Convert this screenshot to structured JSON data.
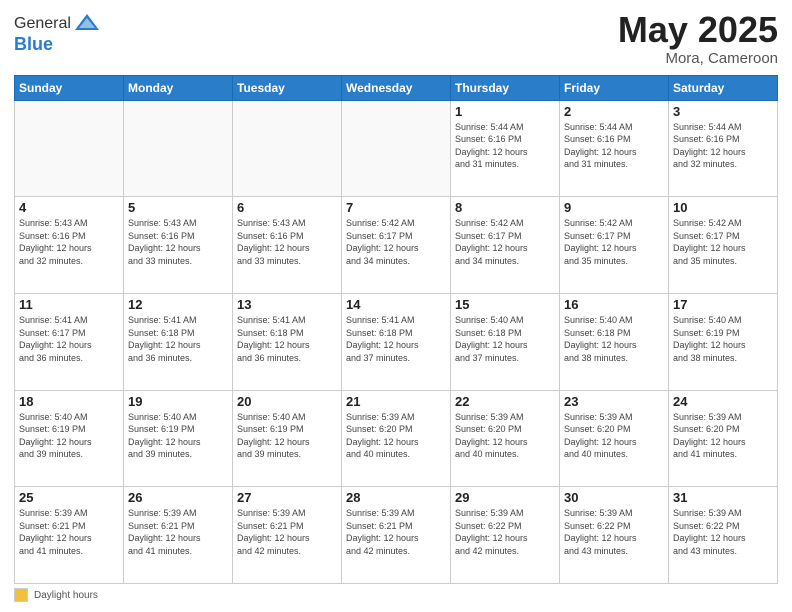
{
  "header": {
    "logo_general": "General",
    "logo_blue": "Blue",
    "title": "May 2025",
    "location": "Mora, Cameroon"
  },
  "weekdays": [
    "Sunday",
    "Monday",
    "Tuesday",
    "Wednesday",
    "Thursday",
    "Friday",
    "Saturday"
  ],
  "weeks": [
    [
      {
        "day": "",
        "info": ""
      },
      {
        "day": "",
        "info": ""
      },
      {
        "day": "",
        "info": ""
      },
      {
        "day": "",
        "info": ""
      },
      {
        "day": "1",
        "info": "Sunrise: 5:44 AM\nSunset: 6:16 PM\nDaylight: 12 hours\nand 31 minutes."
      },
      {
        "day": "2",
        "info": "Sunrise: 5:44 AM\nSunset: 6:16 PM\nDaylight: 12 hours\nand 31 minutes."
      },
      {
        "day": "3",
        "info": "Sunrise: 5:44 AM\nSunset: 6:16 PM\nDaylight: 12 hours\nand 32 minutes."
      }
    ],
    [
      {
        "day": "4",
        "info": "Sunrise: 5:43 AM\nSunset: 6:16 PM\nDaylight: 12 hours\nand 32 minutes."
      },
      {
        "day": "5",
        "info": "Sunrise: 5:43 AM\nSunset: 6:16 PM\nDaylight: 12 hours\nand 33 minutes."
      },
      {
        "day": "6",
        "info": "Sunrise: 5:43 AM\nSunset: 6:16 PM\nDaylight: 12 hours\nand 33 minutes."
      },
      {
        "day": "7",
        "info": "Sunrise: 5:42 AM\nSunset: 6:17 PM\nDaylight: 12 hours\nand 34 minutes."
      },
      {
        "day": "8",
        "info": "Sunrise: 5:42 AM\nSunset: 6:17 PM\nDaylight: 12 hours\nand 34 minutes."
      },
      {
        "day": "9",
        "info": "Sunrise: 5:42 AM\nSunset: 6:17 PM\nDaylight: 12 hours\nand 35 minutes."
      },
      {
        "day": "10",
        "info": "Sunrise: 5:42 AM\nSunset: 6:17 PM\nDaylight: 12 hours\nand 35 minutes."
      }
    ],
    [
      {
        "day": "11",
        "info": "Sunrise: 5:41 AM\nSunset: 6:17 PM\nDaylight: 12 hours\nand 36 minutes."
      },
      {
        "day": "12",
        "info": "Sunrise: 5:41 AM\nSunset: 6:18 PM\nDaylight: 12 hours\nand 36 minutes."
      },
      {
        "day": "13",
        "info": "Sunrise: 5:41 AM\nSunset: 6:18 PM\nDaylight: 12 hours\nand 36 minutes."
      },
      {
        "day": "14",
        "info": "Sunrise: 5:41 AM\nSunset: 6:18 PM\nDaylight: 12 hours\nand 37 minutes."
      },
      {
        "day": "15",
        "info": "Sunrise: 5:40 AM\nSunset: 6:18 PM\nDaylight: 12 hours\nand 37 minutes."
      },
      {
        "day": "16",
        "info": "Sunrise: 5:40 AM\nSunset: 6:18 PM\nDaylight: 12 hours\nand 38 minutes."
      },
      {
        "day": "17",
        "info": "Sunrise: 5:40 AM\nSunset: 6:19 PM\nDaylight: 12 hours\nand 38 minutes."
      }
    ],
    [
      {
        "day": "18",
        "info": "Sunrise: 5:40 AM\nSunset: 6:19 PM\nDaylight: 12 hours\nand 39 minutes."
      },
      {
        "day": "19",
        "info": "Sunrise: 5:40 AM\nSunset: 6:19 PM\nDaylight: 12 hours\nand 39 minutes."
      },
      {
        "day": "20",
        "info": "Sunrise: 5:40 AM\nSunset: 6:19 PM\nDaylight: 12 hours\nand 39 minutes."
      },
      {
        "day": "21",
        "info": "Sunrise: 5:39 AM\nSunset: 6:20 PM\nDaylight: 12 hours\nand 40 minutes."
      },
      {
        "day": "22",
        "info": "Sunrise: 5:39 AM\nSunset: 6:20 PM\nDaylight: 12 hours\nand 40 minutes."
      },
      {
        "day": "23",
        "info": "Sunrise: 5:39 AM\nSunset: 6:20 PM\nDaylight: 12 hours\nand 40 minutes."
      },
      {
        "day": "24",
        "info": "Sunrise: 5:39 AM\nSunset: 6:20 PM\nDaylight: 12 hours\nand 41 minutes."
      }
    ],
    [
      {
        "day": "25",
        "info": "Sunrise: 5:39 AM\nSunset: 6:21 PM\nDaylight: 12 hours\nand 41 minutes."
      },
      {
        "day": "26",
        "info": "Sunrise: 5:39 AM\nSunset: 6:21 PM\nDaylight: 12 hours\nand 41 minutes."
      },
      {
        "day": "27",
        "info": "Sunrise: 5:39 AM\nSunset: 6:21 PM\nDaylight: 12 hours\nand 42 minutes."
      },
      {
        "day": "28",
        "info": "Sunrise: 5:39 AM\nSunset: 6:21 PM\nDaylight: 12 hours\nand 42 minutes."
      },
      {
        "day": "29",
        "info": "Sunrise: 5:39 AM\nSunset: 6:22 PM\nDaylight: 12 hours\nand 42 minutes."
      },
      {
        "day": "30",
        "info": "Sunrise: 5:39 AM\nSunset: 6:22 PM\nDaylight: 12 hours\nand 43 minutes."
      },
      {
        "day": "31",
        "info": "Sunrise: 5:39 AM\nSunset: 6:22 PM\nDaylight: 12 hours\nand 43 minutes."
      }
    ]
  ],
  "footer": {
    "daylight_label": "Daylight hours"
  }
}
